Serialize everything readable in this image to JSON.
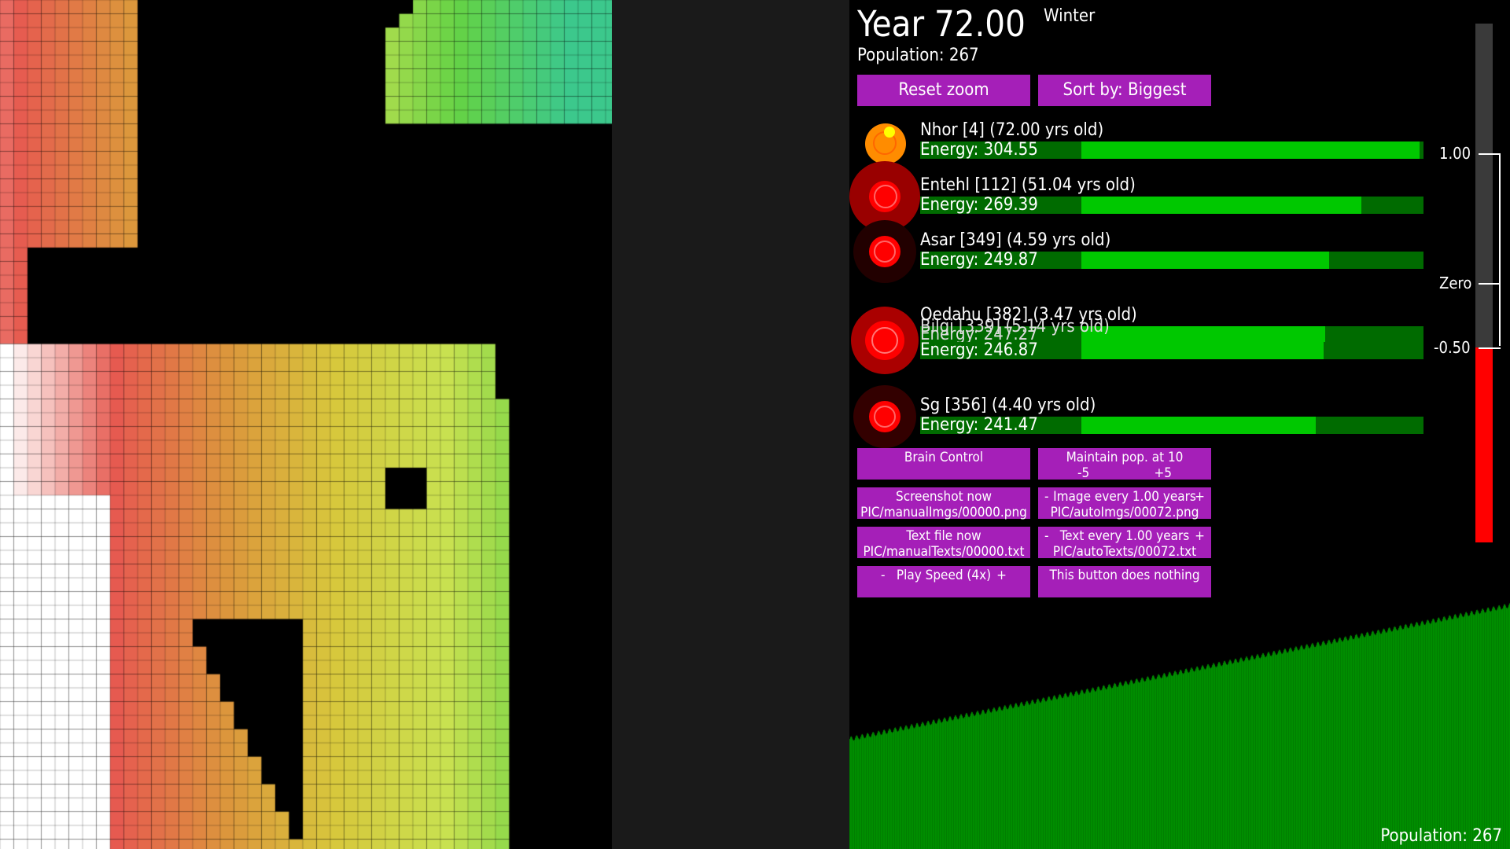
{
  "header": {
    "year": "Year 72.00",
    "season": "Winter",
    "population": "Population: 267"
  },
  "buttons": {
    "reset_zoom": "Reset zoom",
    "sort_by": "Sort by: Biggest",
    "brain_control": "Brain Control",
    "maintain_pop_line1": "Maintain pop. at 10",
    "maintain_pop_minus": "-5",
    "maintain_pop_plus": "+5",
    "screenshot_line1": "Screenshot now",
    "screenshot_line2": "PIC/manualImgs/00000.png",
    "image_every_line1": "Image every 1.00 years",
    "image_every_line2": "PIC/autoImgs/00072.png",
    "text_file_line1": "Text file now",
    "text_file_line2": "PIC/manualTexts/00000.txt",
    "text_every_line1": "Text every 1.00 years",
    "text_every_line2": "PIC/autoTexts/00072.txt",
    "play_speed": "Play Speed (4x)",
    "nothing": "This button does nothing",
    "minus": "-",
    "plus": "+"
  },
  "creatures": [
    {
      "name": "Nhor [4] (72.00 yrs old)",
      "energy_label": "Energy: 304.55",
      "energy": 304.55,
      "color": "#ff8c00"
    },
    {
      "name": "Entehl [112] (51.04 yrs old)",
      "energy_label": "Energy: 269.39",
      "energy": 269.39,
      "color": "#ff0000"
    },
    {
      "name": "Asar [349] (4.59 yrs old)",
      "energy_label": "Energy: 249.87",
      "energy": 249.87,
      "color": "#ff0000"
    },
    {
      "name": "Bilgi [339] (5.14 yrs old)",
      "energy_label": "Energy: 247.27",
      "energy": 247.27,
      "color": "#ff0000"
    },
    {
      "name": "Oedahu [382] (3.47 yrs old)",
      "energy_label": "Energy: 246.87",
      "energy": 246.87,
      "color": "#ff0000"
    },
    {
      "name": "Sg [356] (4.40 yrs old)",
      "energy_label": "Energy: 241.47",
      "energy": 241.47,
      "color": "#ff0000"
    }
  ],
  "scale": {
    "top_label": "1.00",
    "zero_label": "Zero",
    "bottom_label": "-0.50",
    "value": -0.5
  },
  "footer": {
    "population": "Population: 267"
  }
}
